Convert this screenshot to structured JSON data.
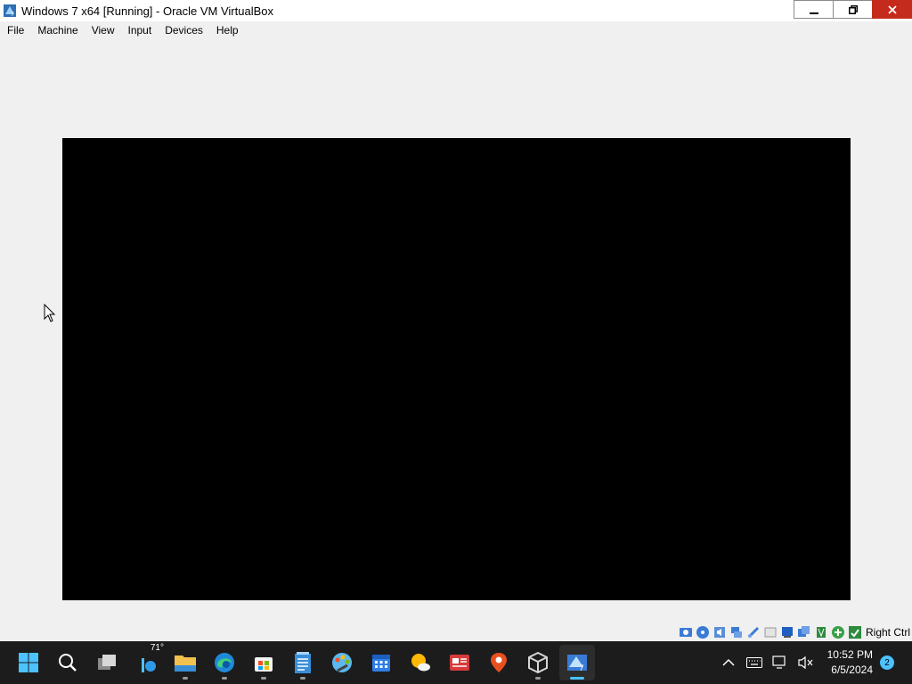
{
  "window": {
    "title": "Windows 7 x64 [Running] - Oracle VM VirtualBox",
    "controls": {
      "minimize": "minimize",
      "restore": "restore",
      "close": "close"
    },
    "close_color": "#c42b1c"
  },
  "menu": {
    "items": [
      {
        "label": "File"
      },
      {
        "label": "Machine"
      },
      {
        "label": "View"
      },
      {
        "label": "Input"
      },
      {
        "label": "Devices"
      },
      {
        "label": "Help"
      }
    ]
  },
  "vm": {
    "screen_color": "#000000"
  },
  "statusbar": {
    "icons": [
      "hard-disk-icon",
      "optical-drive-icon",
      "audio-icon",
      "network-icon",
      "usb-icon",
      "shared-folders-icon",
      "display-icon",
      "recording-icon",
      "cpu-icon",
      "mouse-integration-icon",
      "keyboard-capture-icon"
    ],
    "host_key": "Right Ctrl"
  },
  "taskbar": {
    "apps": [
      {
        "name": "start-button",
        "icon": "windows-logo-icon"
      },
      {
        "name": "search-button",
        "icon": "search-icon"
      },
      {
        "name": "task-view-button",
        "icon": "task-view-icon"
      },
      {
        "name": "widgets-button",
        "icon": "weather-widget-icon"
      },
      {
        "name": "file-explorer-button",
        "icon": "folder-icon"
      },
      {
        "name": "edge-button",
        "icon": "edge-icon"
      },
      {
        "name": "store-button",
        "icon": "store-icon"
      },
      {
        "name": "notepad-button",
        "icon": "notepad-icon"
      },
      {
        "name": "paint-button",
        "icon": "paint-icon"
      },
      {
        "name": "calendar-button",
        "icon": "calendar-icon"
      },
      {
        "name": "weather-button",
        "icon": "weather-icon"
      },
      {
        "name": "news-button",
        "icon": "news-icon"
      },
      {
        "name": "maps-button",
        "icon": "maps-pin-icon"
      },
      {
        "name": "virtualbox-button",
        "icon": "virtualbox-icon"
      },
      {
        "name": "vm-window-button",
        "icon": "vm-window-icon"
      }
    ],
    "temperature": "71°",
    "accent": "#4cc2ff",
    "tray": {
      "clock_time": "10:52 PM",
      "clock_date": "6/5/2024",
      "notification_count": "2"
    }
  }
}
